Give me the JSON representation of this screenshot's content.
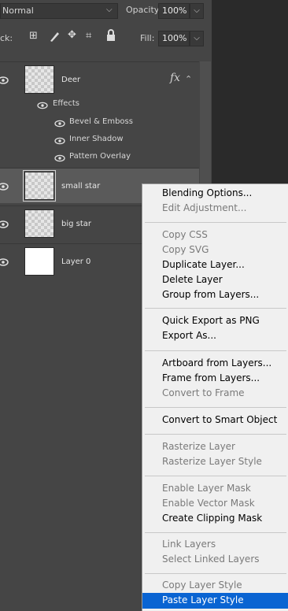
{
  "toolbar": {
    "blend_mode": "Normal",
    "opacity_label": "Opacity:",
    "opacity_value": "100%",
    "lock_label": "ck:",
    "fill_label": "Fill:",
    "fill_value": "100%"
  },
  "layers": {
    "deer": {
      "name": "Deer",
      "fx": "fx"
    },
    "effects_label": "Effects",
    "effects": [
      "Bevel & Emboss",
      "Inner Shadow",
      "Pattern Overlay"
    ],
    "small_star": {
      "name": "small star"
    },
    "big_star": {
      "name": "big star"
    },
    "layer0": {
      "name": "Layer 0"
    }
  },
  "context_menu": {
    "items": [
      {
        "label": "Blending Options...",
        "enabled": true
      },
      {
        "label": "Edit Adjustment...",
        "enabled": false
      },
      {
        "label": "Copy CSS",
        "enabled": false
      },
      {
        "label": "Copy SVG",
        "enabled": false
      },
      {
        "label": "Duplicate Layer...",
        "enabled": true
      },
      {
        "label": "Delete Layer",
        "enabled": true
      },
      {
        "label": "Group from Layers...",
        "enabled": true
      },
      {
        "label": "Quick Export as PNG",
        "enabled": true
      },
      {
        "label": "Export As...",
        "enabled": true
      },
      {
        "label": "Artboard from Layers...",
        "enabled": true
      },
      {
        "label": "Frame from Layers...",
        "enabled": true
      },
      {
        "label": "Convert to Frame",
        "enabled": false
      },
      {
        "label": "Convert to Smart Object",
        "enabled": true
      },
      {
        "label": "Rasterize Layer",
        "enabled": false
      },
      {
        "label": "Rasterize Layer Style",
        "enabled": false
      },
      {
        "label": "Enable Layer Mask",
        "enabled": false
      },
      {
        "label": "Enable Vector Mask",
        "enabled": false
      },
      {
        "label": "Create Clipping Mask",
        "enabled": true
      },
      {
        "label": "Link Layers",
        "enabled": false
      },
      {
        "label": "Select Linked Layers",
        "enabled": false
      },
      {
        "label": "Copy Layer Style",
        "enabled": false
      },
      {
        "label": "Paste Layer Style",
        "enabled": true,
        "highlighted": true
      }
    ]
  }
}
